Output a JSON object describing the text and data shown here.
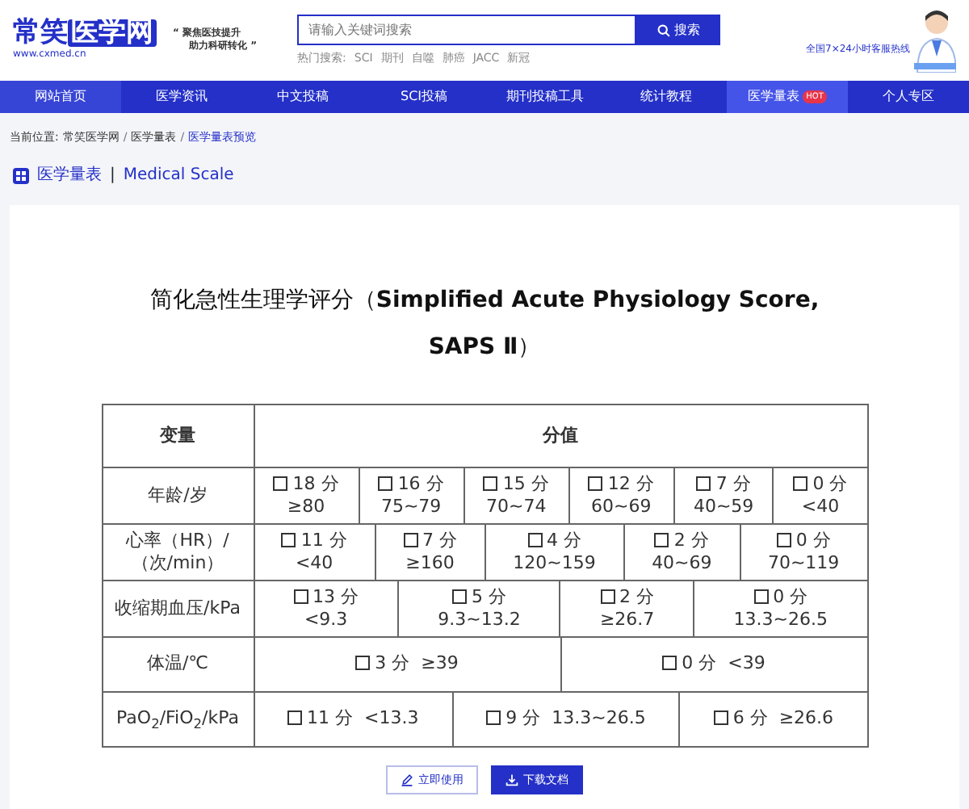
{
  "header": {
    "logo": {
      "plain": "常笑",
      "boxed": "医学网",
      "url": "www.cxmed.cn"
    },
    "slogan": [
      "“ 聚焦医技提升",
      "助力科研转化 ”"
    ],
    "search": {
      "placeholder": "请输入关键词搜索",
      "button": "搜索"
    },
    "hot": {
      "label": "热门搜索:",
      "terms": [
        "SCI",
        "期刊",
        "自噬",
        "肺癌",
        "JACC",
        "新冠"
      ]
    },
    "hotline": {
      "label": "全国7×24小时客服热线"
    }
  },
  "nav": [
    {
      "label": "网站首页",
      "kind": "home",
      "selected": false
    },
    {
      "label": "医学资讯",
      "kind": "plain",
      "selected": false
    },
    {
      "label": "中文投稿",
      "kind": "plain",
      "selected": false
    },
    {
      "label": "SCI投稿",
      "kind": "plain",
      "selected": false
    },
    {
      "label": "期刊投稿工具",
      "kind": "plain",
      "selected": false
    },
    {
      "label": "统计教程",
      "kind": "plain",
      "selected": false
    },
    {
      "label": "医学量表",
      "kind": "plain",
      "selected": true,
      "badge": "HOT"
    },
    {
      "label": "个人专区",
      "kind": "plain",
      "selected": false
    }
  ],
  "breadcrumb": {
    "label": "当前位置:",
    "separator": "/",
    "items": [
      "常笑医学网",
      "医学量表",
      "医学量表预览"
    ]
  },
  "section": {
    "title": "医学量表",
    "separator": "|",
    "subtitle": "Medical Scale"
  },
  "document": {
    "title_lines": [
      "简化急性生理学评分（**Simplified Acute Physiology Score,**",
      "**SAPS Ⅱ**）"
    ],
    "table": {
      "columns": [
        "变量",
        "分值"
      ],
      "rows": [
        {
          "variable": "年龄/岁",
          "kind": "stacked",
          "options": [
            {
              "score": "18 分",
              "range": "≥80",
              "checked": false
            },
            {
              "score": "16 分",
              "range": "75~79",
              "checked": false
            },
            {
              "score": "15 分",
              "range": "70~74",
              "checked": false
            },
            {
              "score": "12 分",
              "range": "60~69",
              "checked": false
            },
            {
              "score": "7 分",
              "range": "40~59",
              "checked": false
            },
            {
              "score": "0 分",
              "range": "<40",
              "checked": false
            }
          ]
        },
        {
          "variable": "心率（HR）/（次/min）",
          "kind": "stacked",
          "options": [
            {
              "score": "11 分",
              "range": "<40",
              "checked": false
            },
            {
              "score": "7 分",
              "range": "≥160",
              "checked": false
            },
            {
              "score": "4 分",
              "range": "120~159",
              "checked": false
            },
            {
              "score": "2 分",
              "range": "40~69",
              "checked": false
            },
            {
              "score": "0 分",
              "range": "70~119",
              "checked": false
            }
          ]
        },
        {
          "variable": "收缩期血压/kPa",
          "kind": "stacked",
          "options": [
            {
              "score": "13 分",
              "range": "<9.3",
              "checked": false
            },
            {
              "score": "5 分",
              "range": "9.3~13.2",
              "checked": false
            },
            {
              "score": "2 分",
              "range": "≥26.7",
              "checked": false
            },
            {
              "score": "0 分",
              "range": "13.3~26.5",
              "checked": false
            }
          ]
        },
        {
          "variable": "体温/℃",
          "kind": "inline",
          "options": [
            {
              "score": "3 分",
              "range": "≥39",
              "checked": false
            },
            {
              "score": "0 分",
              "range": "<39",
              "checked": false
            }
          ]
        },
        {
          "variable": "PaO$_{2}$/FiO$_{2}$/kPa",
          "kind": "inline",
          "options": [
            {
              "score": "11 分",
              "range": "<13.3",
              "checked": false
            },
            {
              "score": "9 分",
              "range": "13.3~26.5",
              "checked": false
            },
            {
              "score": "6 分",
              "range": "≥26.6",
              "checked": false
            }
          ]
        }
      ]
    }
  },
  "actions": [
    {
      "label": "立即使用",
      "kind": "outline"
    },
    {
      "label": "下载文档",
      "kind": "primary"
    }
  ]
}
